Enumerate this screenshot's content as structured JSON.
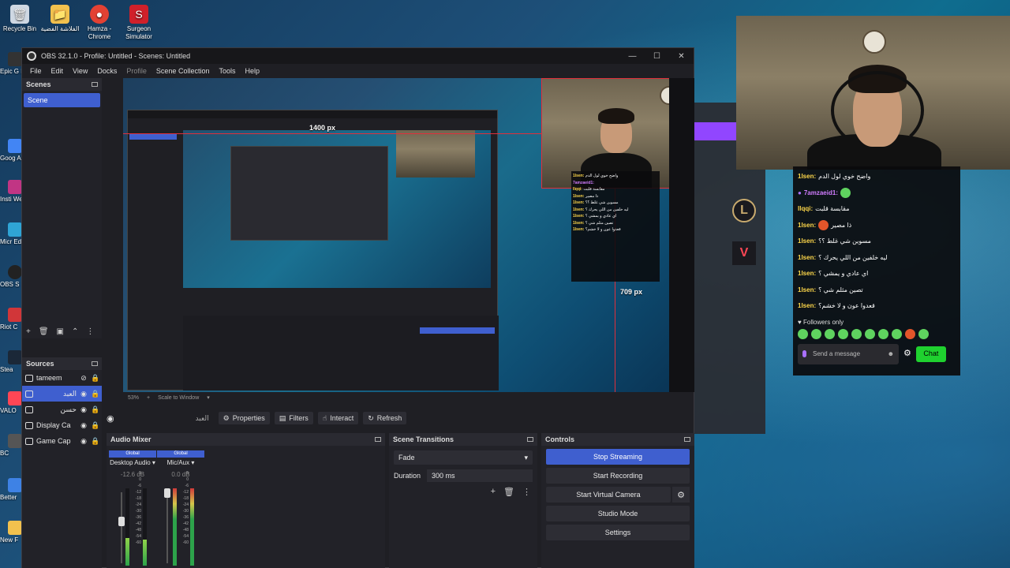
{
  "desktop": {
    "icons": [
      {
        "label": "Recycle Bin",
        "icon": "recycle-bin-icon",
        "color": "#cfd8e3"
      },
      {
        "label": "الفلاشة الفضية",
        "icon": "folder-icon",
        "color": "#f2c14e"
      },
      {
        "label": "Hamza - Chrome",
        "icon": "chrome-icon",
        "color": "#e34133"
      },
      {
        "label": "Surgeon Simulator",
        "icon": "surgeon-simulator-icon",
        "color": "#d0202a"
      }
    ],
    "left_strip": [
      "Epic G Laun",
      "Goog Assis",
      "Insti Web",
      "Micr Ed",
      "OBS S",
      "Riot C",
      "Stea",
      "VALO",
      "BC",
      "Better",
      "New F"
    ]
  },
  "obs": {
    "title": "OBS 32.1.0 - Profile: Untitled - Scenes: Untitled",
    "menu": [
      "File",
      "Edit",
      "View",
      "Docks",
      "Profile",
      "Scene Collection",
      "Tools",
      "Help"
    ],
    "scenes_title": "Scenes",
    "scenes": [
      "Scene"
    ],
    "sources_title": "Sources",
    "sources": [
      {
        "name": "tameem",
        "visible": false,
        "selected": false
      },
      {
        "name": "العبد",
        "visible": true,
        "selected": true
      },
      {
        "name": "حسن",
        "visible": true,
        "selected": false
      },
      {
        "name": "Display Ca",
        "visible": true,
        "selected": false
      },
      {
        "name": "Game Cap",
        "visible": true,
        "selected": false
      }
    ],
    "preview": {
      "width_label": "1400 px",
      "height_label": "709 px",
      "zoom": "53%",
      "scale_mode": "Scale to Window"
    },
    "source_toolbar": {
      "selected_name": "العبد",
      "properties": "Properties",
      "filters": "Filters",
      "interact": "Interact",
      "refresh": "Refresh"
    },
    "audio_mixer": {
      "title": "Audio Mixer",
      "channels": [
        {
          "global": "Global",
          "name": "Desktop Audio",
          "db": "-12.6 dB",
          "level": 0.55
        },
        {
          "global": "Global",
          "name": "Mic/Aux",
          "db": "0.0 dB",
          "level": 0.75
        }
      ],
      "scale": [
        "5",
        "0",
        "-6",
        "-12",
        "-18",
        "-24",
        "-30",
        "-36",
        "-42",
        "-48",
        "-54",
        "-60"
      ]
    },
    "scene_transitions": {
      "title": "Scene Transitions",
      "transition": "Fade",
      "duration_label": "Duration",
      "duration_value": "300 ms"
    },
    "controls": {
      "title": "Controls",
      "stop_streaming": "Stop Streaming",
      "start_recording": "Start Recording",
      "start_virtual_camera": "Start Virtual Camera",
      "studio_mode": "Studio Mode",
      "settings": "Settings"
    }
  },
  "chat": {
    "messages": [
      {
        "user": "1lsen:",
        "text": "واضح خوي لول الدم"
      },
      {
        "user": "7amzaeid1:",
        "text": "",
        "purple": true
      },
      {
        "user": "llqqi:",
        "text": "مقابسة قلبت"
      },
      {
        "user": "1lsen:",
        "text": "ذا مصير"
      },
      {
        "user": "1lsen:",
        "text": "مسوين شي غلط ؟؟"
      },
      {
        "user": "1lsen:",
        "text": "ليه خلفين من اللي يحرك ؟"
      },
      {
        "user": "1lsen:",
        "text": "اي عادي و يمشي ؟"
      },
      {
        "user": "1lsen:",
        "text": "تصين مثلم شي ؟"
      },
      {
        "user": "1lsen:",
        "text": "قعدوا عون و لا خشم؟"
      }
    ],
    "followers_only": "Followers only",
    "input_placeholder": "Send a message",
    "chat_button": "Chat"
  },
  "colors": {
    "accent": "#3f5fcf",
    "twitch_purple": "#9146ff",
    "chat_green": "#1fd12f",
    "selection_red": "#e12f3b"
  }
}
